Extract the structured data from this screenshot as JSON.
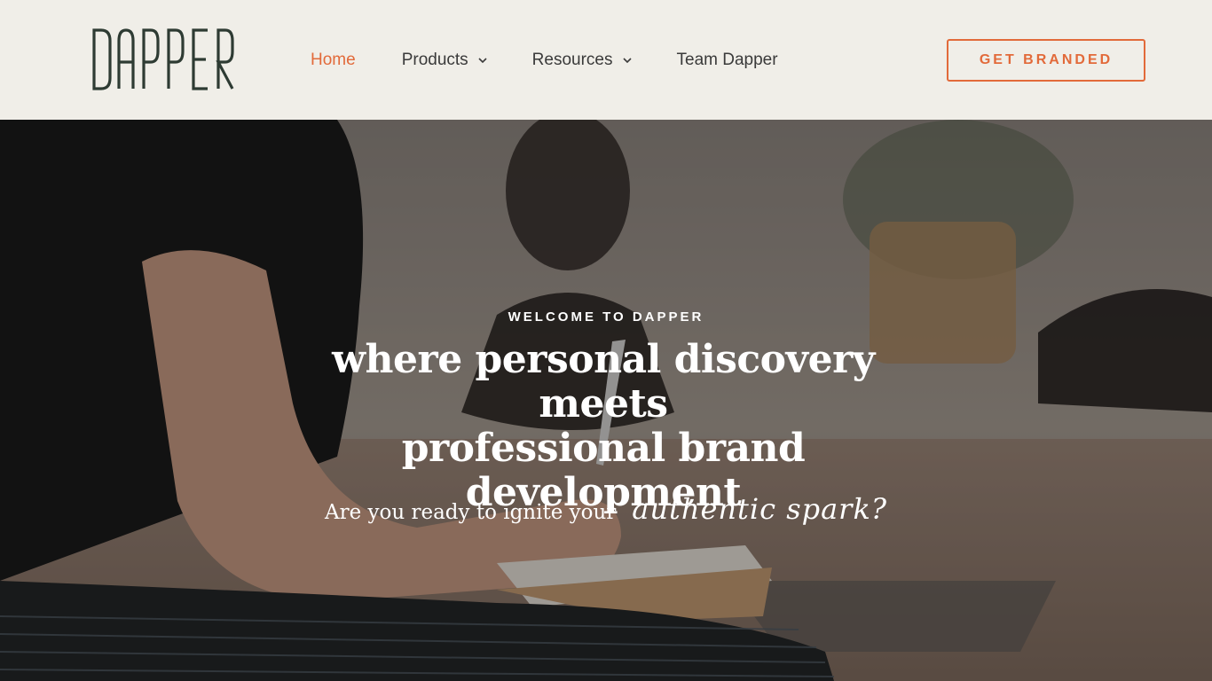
{
  "header": {
    "logo_text": "DAPPER",
    "nav": [
      {
        "label": "Home",
        "active": true,
        "has_dropdown": false
      },
      {
        "label": "Products",
        "active": false,
        "has_dropdown": true
      },
      {
        "label": "Resources",
        "active": false,
        "has_dropdown": true
      },
      {
        "label": "Team Dapper",
        "active": false,
        "has_dropdown": false
      }
    ],
    "cta_label": "GET BRANDED"
  },
  "hero": {
    "eyebrow": "WELCOME TO DAPPER",
    "headline_line1": "where personal discovery meets",
    "headline_line2": "professional brand development",
    "tagline_main": "Are you ready to ignite your",
    "tagline_script": "authentic spark?"
  },
  "colors": {
    "accent": "#e26a3a",
    "logo": "#2e3b33",
    "header_bg": "#f0eee8",
    "nav_text": "#3a3a3a"
  },
  "icons": {
    "chevron": "chevron-down-icon"
  }
}
